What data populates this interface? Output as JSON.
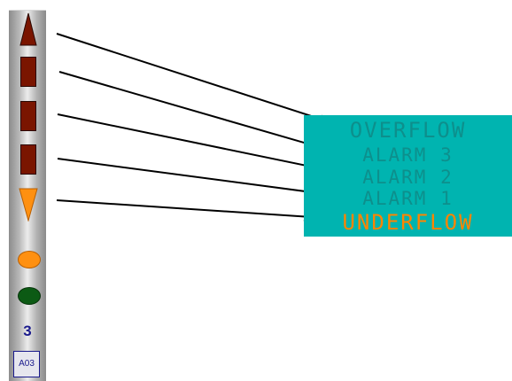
{
  "colors": {
    "alarm_fill": "#7a1500",
    "underflow_orange": "#ff9010",
    "ok_green": "#0c5a14",
    "panel_teal": "#00b4b0",
    "label_dim": "#0d8f8c",
    "label_active": "#ff8400",
    "counter_blue": "#1a1a8c"
  },
  "indicator_strip": {
    "items": [
      {
        "name": "overflow",
        "icon": "triangle-up-icon"
      },
      {
        "name": "alarm-3",
        "icon": "rectangle-icon"
      },
      {
        "name": "alarm-2",
        "icon": "rectangle-icon"
      },
      {
        "name": "alarm-1",
        "icon": "rectangle-icon"
      },
      {
        "name": "underflow",
        "icon": "triangle-down-icon"
      }
    ],
    "orange_lamp": "orange-circle-icon",
    "green_lamp": "green-circle-icon",
    "count": "3",
    "tag": "A03"
  },
  "legend": {
    "overflow": "OVERFLOW",
    "alarm3": "ALARM 3",
    "alarm2": "ALARM 2",
    "alarm1": "ALARM 1",
    "underflow": "UNDERFLOW"
  }
}
